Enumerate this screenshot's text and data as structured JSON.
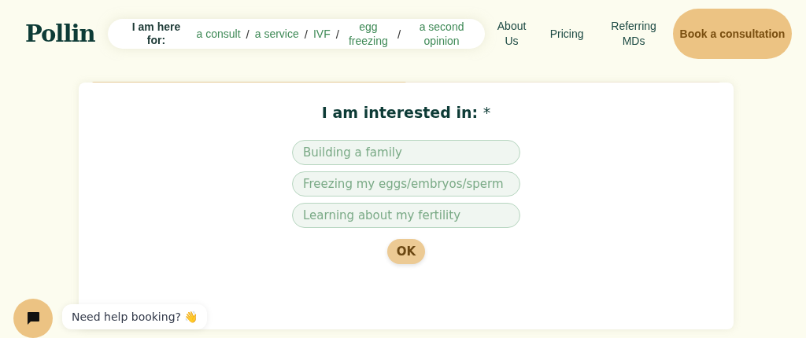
{
  "header": {
    "logo": "Pollin",
    "here_for_label": "I am here for:",
    "here_for_links": [
      "a consult",
      "a service",
      "IVF",
      "egg freezing",
      "a second opinion"
    ],
    "separators": [
      "/",
      "/",
      "/",
      "/"
    ],
    "nav": [
      "About Us",
      "Pricing",
      "Referring MDs"
    ],
    "cta": "Book a consultation"
  },
  "form": {
    "progress": {
      "level": 0.5
    },
    "question": "I am interested in:",
    "required_mark": "*",
    "options": [
      {
        "label": "Building a family",
        "selected": false
      },
      {
        "label": "Freezing my eggs/embryos/sperm",
        "selected": false
      },
      {
        "label": "Learning about my fertility",
        "selected": false
      }
    ],
    "ok_button": "OK"
  },
  "chat": {
    "bubble": "Need help booking? 👋"
  }
}
